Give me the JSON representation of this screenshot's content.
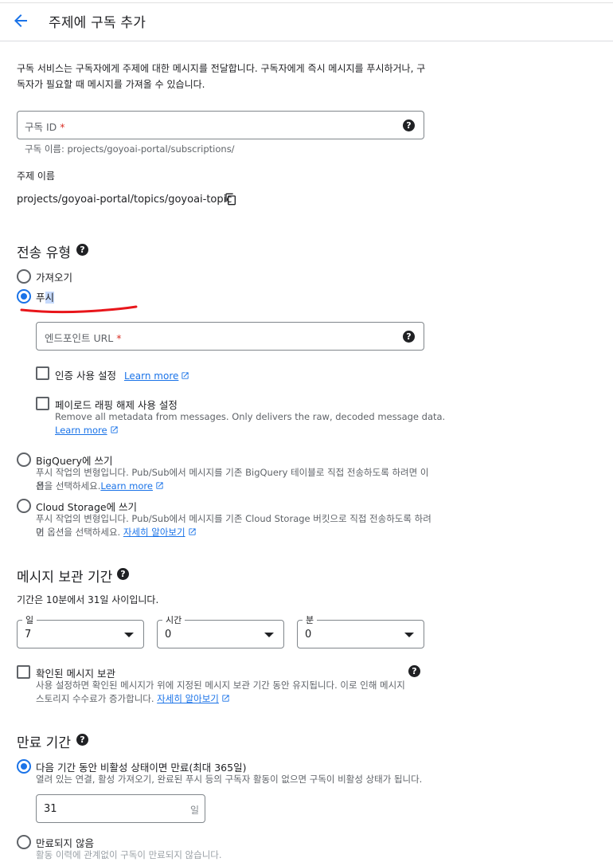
{
  "header": {
    "title": "주제에 구독 추가"
  },
  "intro": {
    "text": "구독 서비스는 구독자에게 주제에 대한 메시지를 전달합니다. 구독자에게 즉시 메시지를 푸시하거나, 구독자가 필요할 때 메시지를 가져올 수 있습니다."
  },
  "subscription_id": {
    "label": "구독 ID",
    "required_mark": "*",
    "value": "",
    "hint": "구독 이름: projects/goyoai-portal/subscriptions/"
  },
  "topic": {
    "label": "주제 이름",
    "value": "projects/goyoai-portal/topics/goyoai-topic"
  },
  "delivery": {
    "heading": "전송 유형",
    "pull_label": "가져오기",
    "push_label_a": "푸",
    "push_label_b": "시",
    "selected": "푸시",
    "endpoint_label": "엔드포인트 URL",
    "endpoint_required": "*",
    "auth_label": "인증 사용 설정",
    "auth_link": "Learn more",
    "unwrap_label": "페이로드 래핑 해제 사용 설정",
    "unwrap_desc": "Remove all metadata from messages. Only delivers the raw, decoded message data.",
    "unwrap_link": "Learn more",
    "bq_label": "BigQuery에 쓰기",
    "bq_desc_1": "푸시 작업의 변형입니다. Pub/Sub에서 메시지를 기존 BigQuery 테이블로 직접 전송하도록 하려면 이 옵",
    "bq_desc_2": "션을 선택하세요.",
    "bq_link": "Learn more",
    "gcs_label": "Cloud Storage에 쓰기",
    "gcs_desc_1": "푸시 작업의 변형입니다. Pub/Sub에서 메시지를 기존 Cloud Storage 버킷으로 직접 전송하도록 하려면",
    "gcs_desc_2": "이 옵션을 선택하세요.",
    "gcs_link": "자세히 알아보기"
  },
  "retention": {
    "heading": "메시지 보관 기간",
    "range_text": "기간은 10분에서 31일 사이입니다.",
    "day_label": "일",
    "day_value": "7",
    "hour_label": "시간",
    "hour_value": "0",
    "minute_label": "분",
    "minute_value": "0",
    "acked_label": "확인된 메시지 보관",
    "acked_desc_1": "사용 설정하면 확인된 메시지가 위에 지정된 메시지 보관 기간 동안 유지됩니다. 이로 인해 메시지",
    "acked_desc_2": "스토리지 수수료가 증가합니다.",
    "acked_link": "자세히 알아보기"
  },
  "expiration": {
    "heading": "만료 기간",
    "inactive_label": "다음 기간 동안 비활성 상태이면 만료(최대 365일)",
    "inactive_desc": "열려 있는 연결, 활성 가져오기, 완료된 푸시 등의 구독자 활동이 없으면 구독이 비활성 상태가 됩니다.",
    "days_value": "31",
    "days_suffix": "일",
    "never_label": "만료되지 않음",
    "cut_text": "활동 이력에 관계없이 구독이 만료되지 않습니다."
  },
  "colors": {
    "accent": "#1a73e8",
    "annotation": "#e8161b"
  }
}
